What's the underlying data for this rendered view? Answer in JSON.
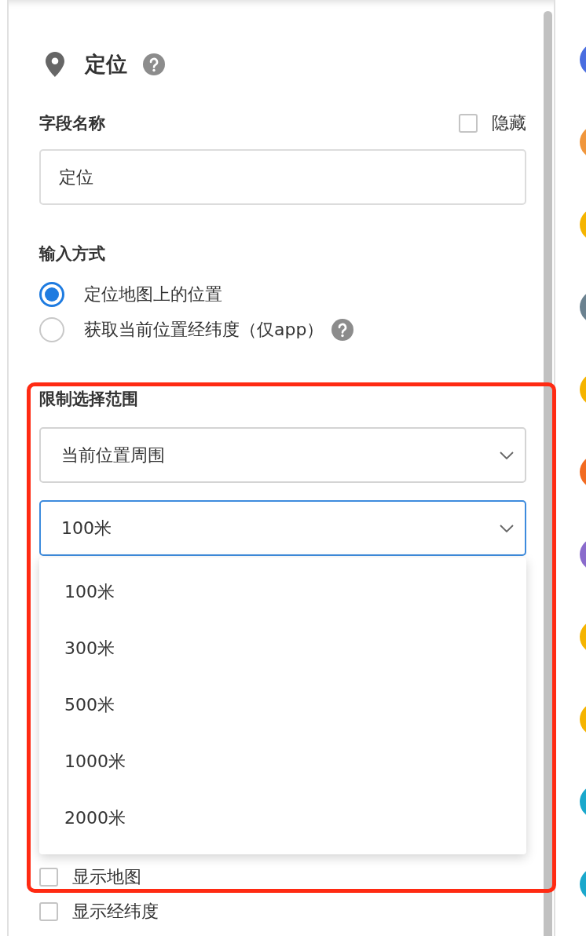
{
  "header": {
    "title": "定位",
    "help": true
  },
  "field_name": {
    "label": "字段名称",
    "hide": {
      "label": "隐藏",
      "checked": false
    },
    "value": "定位"
  },
  "input_mode": {
    "label": "输入方式",
    "options": [
      {
        "label": "定位地图上的位置",
        "selected": true,
        "help": false
      },
      {
        "label": "获取当前位置经纬度（仅app）",
        "selected": false,
        "help": true
      }
    ]
  },
  "range": {
    "label": "限制选择范围",
    "scope_select": {
      "value": "当前位置周围",
      "focused": false
    },
    "distance_select": {
      "value": "100米",
      "focused": true
    },
    "menu": [
      {
        "label": "100米"
      },
      {
        "label": "300米"
      },
      {
        "label": "500米"
      },
      {
        "label": "1000米"
      },
      {
        "label": "2000米"
      }
    ]
  },
  "options": [
    {
      "label": "显示地图",
      "checked": false
    },
    {
      "label": "显示经纬度",
      "checked": false
    }
  ],
  "side_icons": [
    {
      "color": "#4a6ee0"
    },
    {
      "color": "#f0963c"
    },
    {
      "color": "#f5b400"
    },
    {
      "color": "#6b8290"
    },
    {
      "color": "#f5b400"
    },
    {
      "color": "#f26b21"
    },
    {
      "color": "#8a6bcc"
    },
    {
      "color": "#f5b400"
    },
    {
      "color": "#f5b400"
    },
    {
      "color": "#1aa8cc"
    },
    {
      "color": "#1aa8cc"
    }
  ]
}
